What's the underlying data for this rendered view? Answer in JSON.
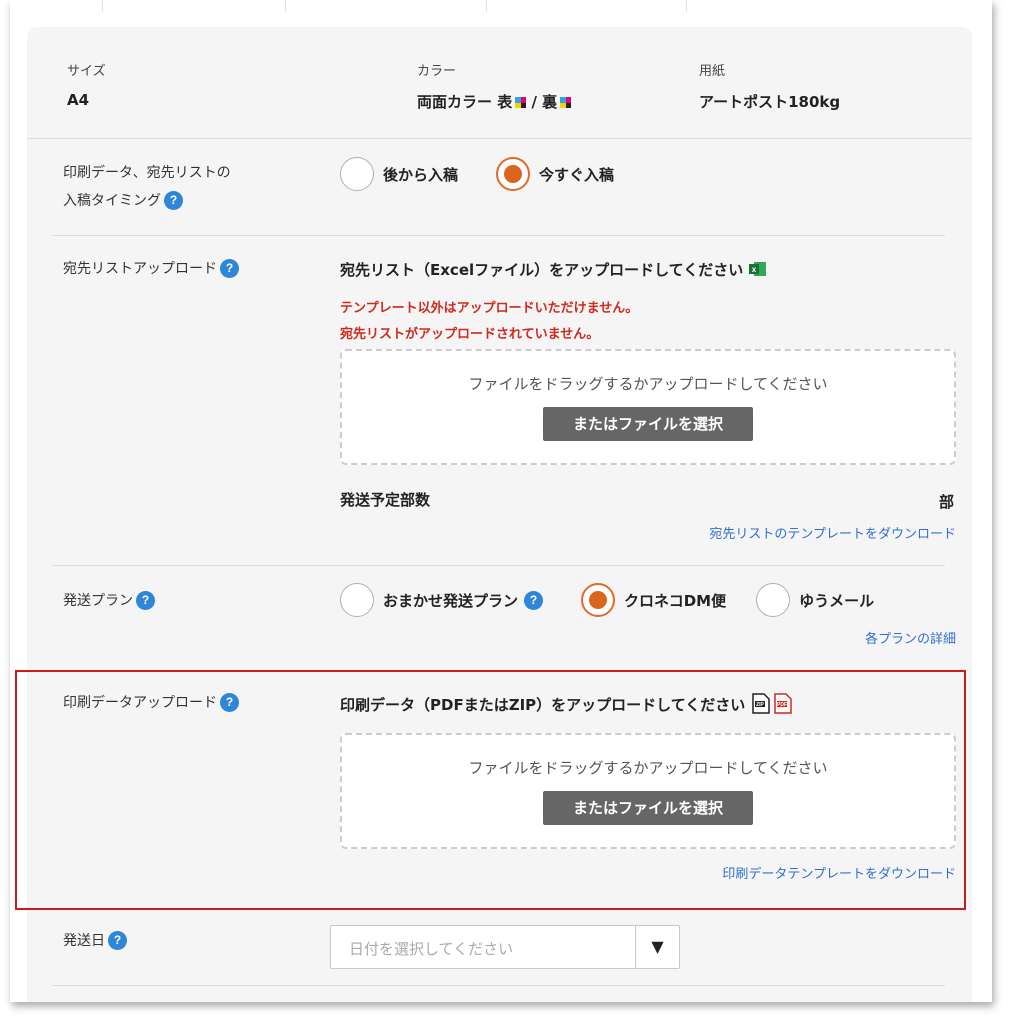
{
  "summary": {
    "size_label": "サイズ",
    "size_value": "A4",
    "color_label": "カラー",
    "color_value": "両面カラー 表",
    "color_sep": " / 裏",
    "paper_label": "用紙",
    "paper_value": "アートポスト180kg"
  },
  "timing": {
    "label_line1": "印刷データ、宛先リストの",
    "label_line2": "入稿タイミング",
    "options": [
      "後から入稿",
      "今すぐ入稿"
    ],
    "selected": "今すぐ入稿"
  },
  "address_list": {
    "label": "宛先リストアップロード",
    "heading": "宛先リスト（Excelファイル）をアップロードしてください",
    "error1": "テンプレート以外はアップロードいただけません。",
    "error2": "宛先リストがアップロードされていません。",
    "drop_text": "ファイルをドラッグするかアップロードしてください",
    "select_button": "またはファイルを選択",
    "count_label": "発送予定部数",
    "count_unit": "部",
    "template_link": "宛先リストのテンプレートをダウンロード"
  },
  "plan": {
    "label": "発送プラン",
    "options": [
      "おまかせ発送プラン",
      "クロネコDM便",
      "ゆうメール"
    ],
    "selected": "クロネコDM便",
    "details_link": "各プランの詳細"
  },
  "print_data": {
    "label": "印刷データアップロード",
    "heading": "印刷データ（PDFまたはZIP）をアップロードしてください",
    "drop_text": "ファイルをドラッグするかアップロードしてください",
    "select_button": "またはファイルを選択",
    "template_link": "印刷データテンプレートをダウンロード"
  },
  "ship_date": {
    "label": "発送日",
    "placeholder": "日付を選択してください",
    "arrow": "▼"
  },
  "help_glyph": "?",
  "colors": {
    "accent": "#d9661c",
    "link": "#2f6fd0",
    "error": "#d0281c",
    "help": "#2f86d8",
    "highlight": "#cc1b1b"
  }
}
